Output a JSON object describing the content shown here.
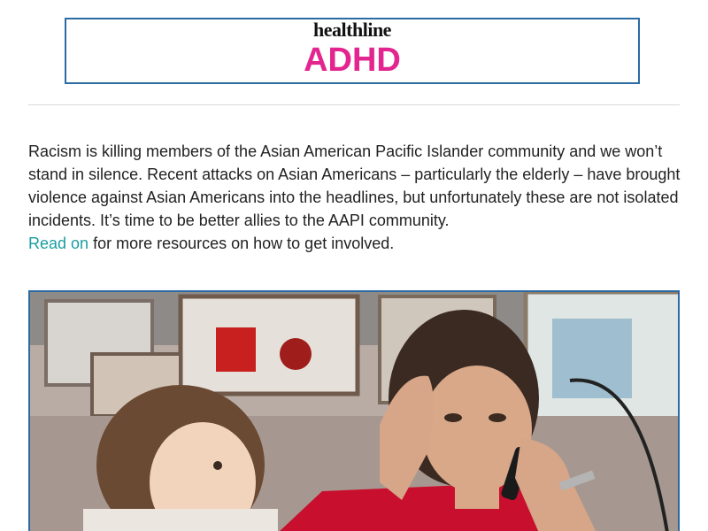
{
  "header": {
    "logo": "healthline",
    "title": "ADHD"
  },
  "intro": {
    "text": "Racism is killing members of the Asian American Pacific Islander community and we won’t stand in silence. Recent attacks on Asian Americans – particularly the elderly – have brought violence against Asian Americans into the headlines, but unfortunately these are not isolated incidents. It’s time to be better allies to the AAPI community.",
    "link_text": "Read on",
    "after_link": "for more resources on how to get involved."
  },
  "colors": {
    "accent_pink": "#e3258f",
    "link_teal": "#1a9da1",
    "frame_blue": "#2c6aa3"
  },
  "hero_image": {
    "icon": "photo-mother-on-phone-with-toddler"
  }
}
